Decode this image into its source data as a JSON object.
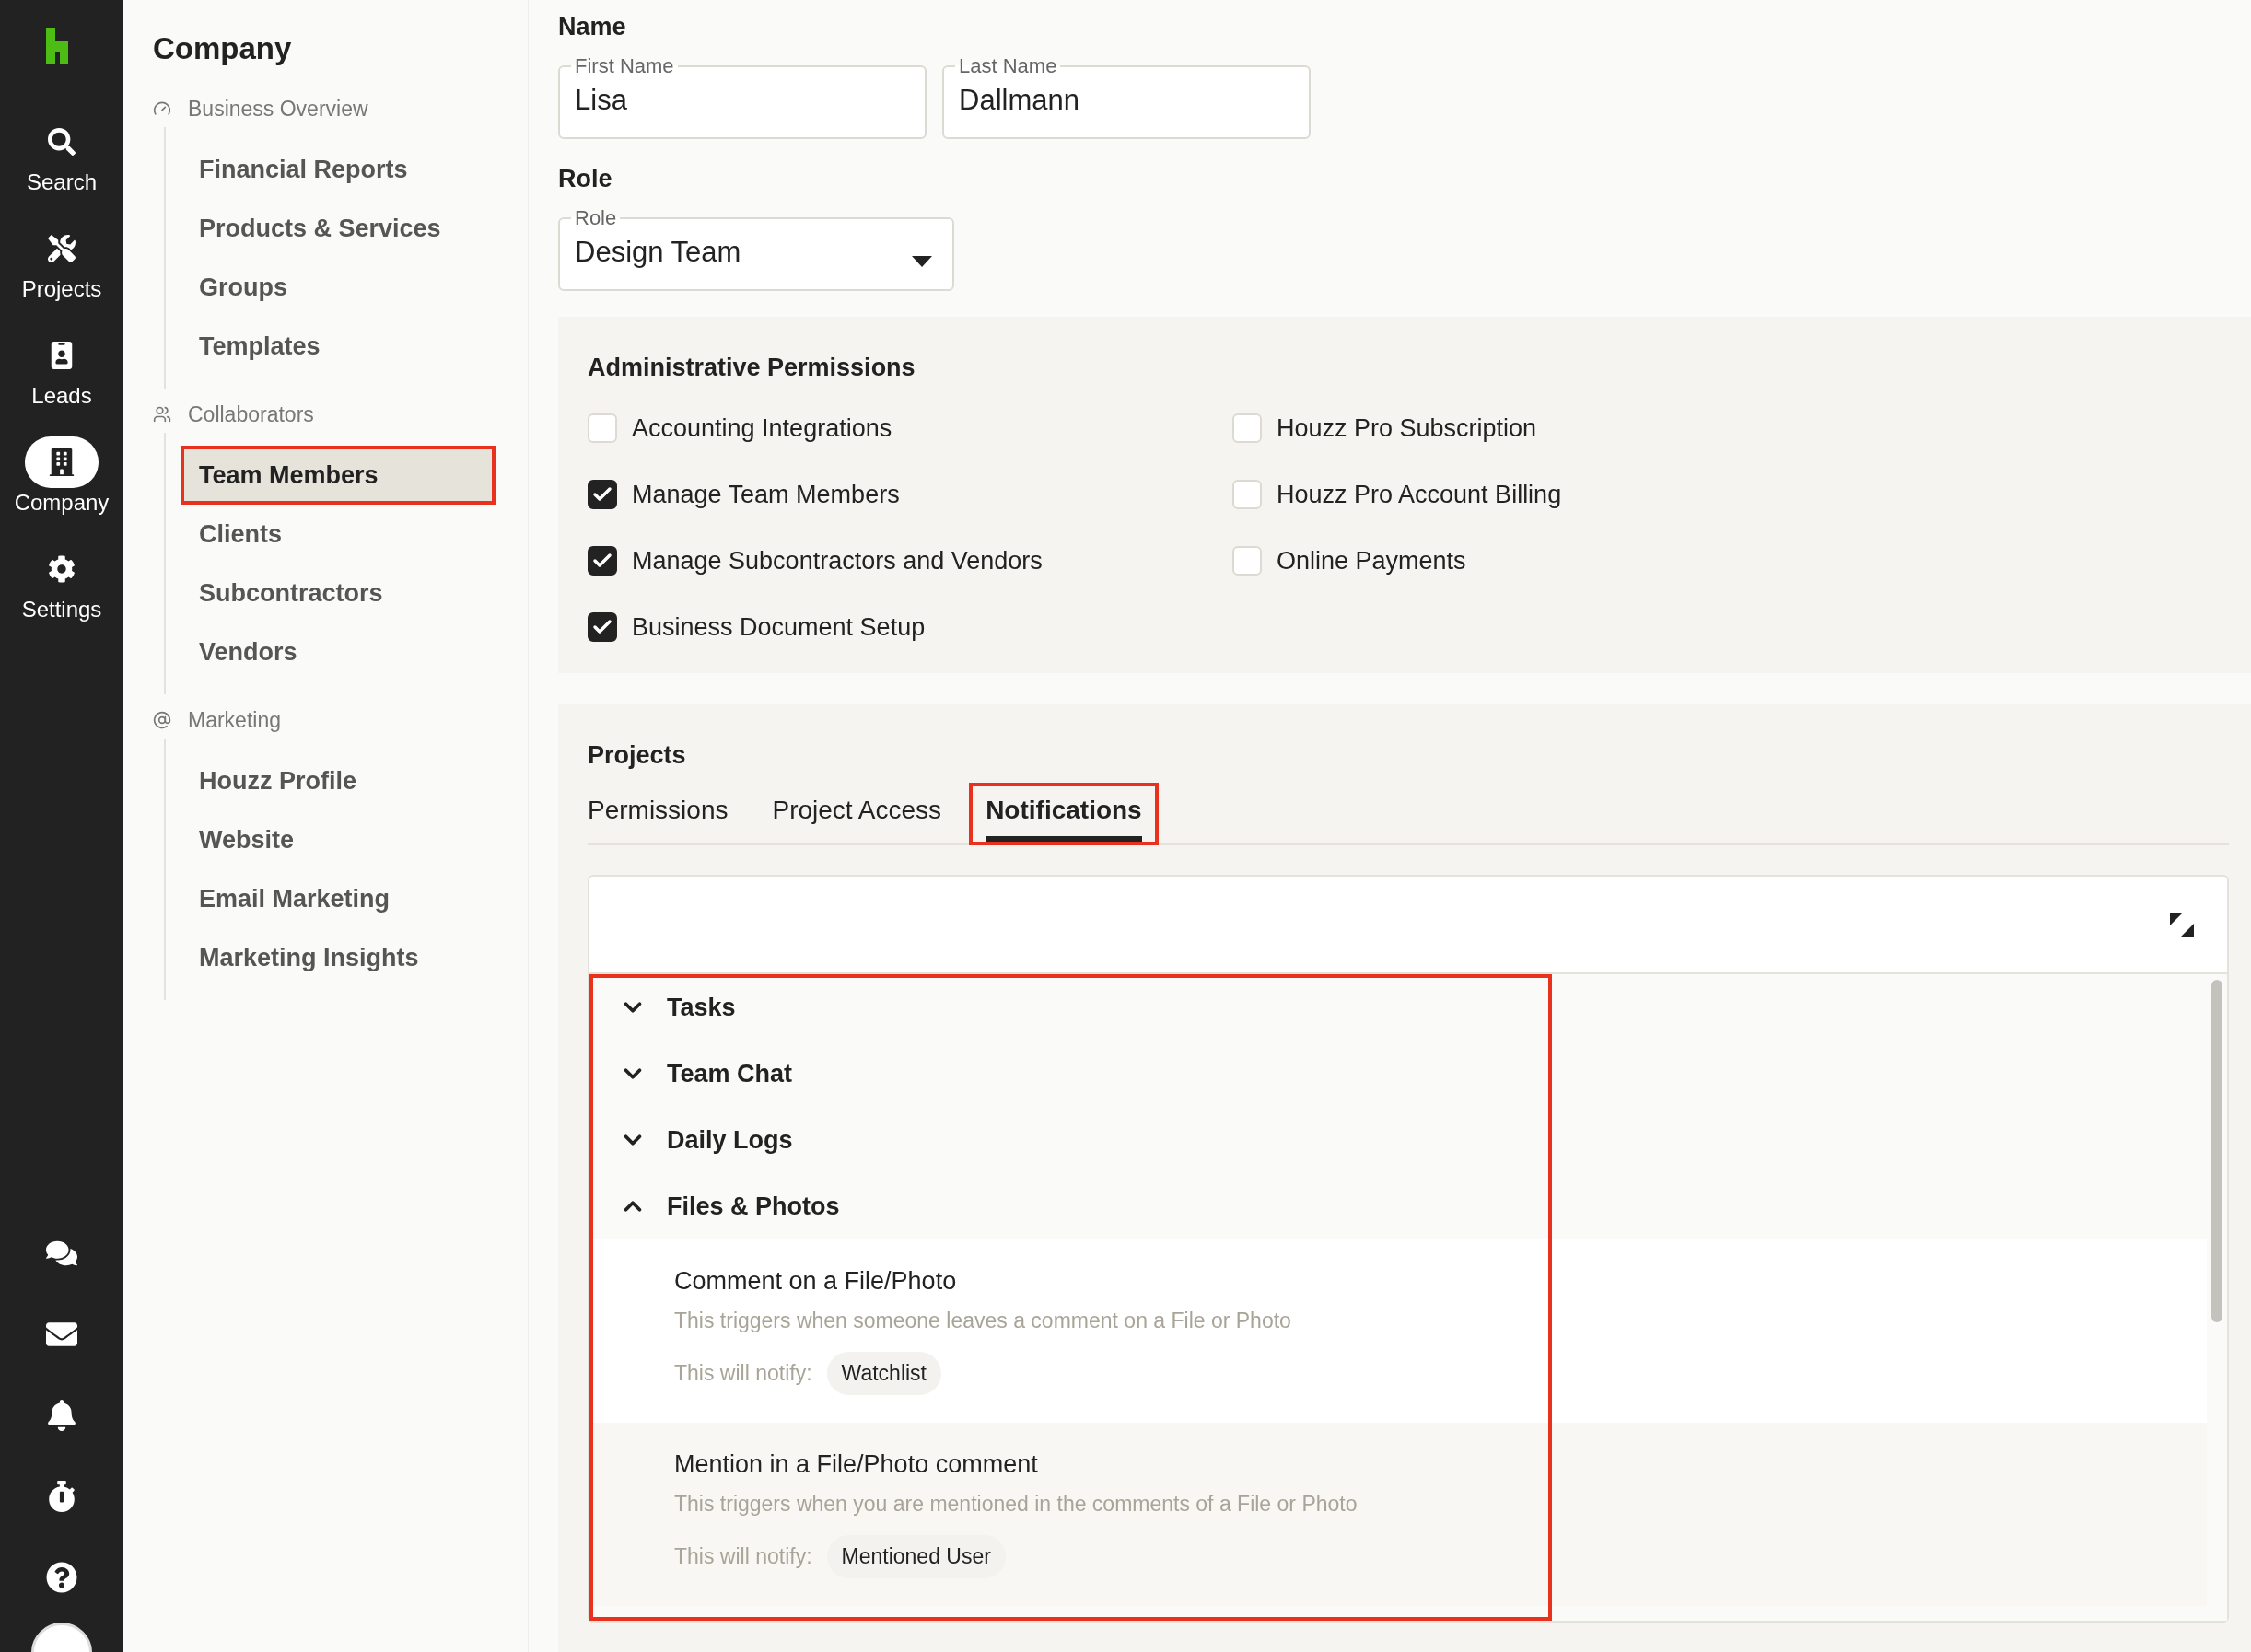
{
  "rail": {
    "items": [
      {
        "label": "Search",
        "selected": false
      },
      {
        "label": "Projects",
        "selected": false
      },
      {
        "label": "Leads",
        "selected": false
      },
      {
        "label": "Company",
        "selected": true
      },
      {
        "label": "Settings",
        "selected": false
      }
    ]
  },
  "nav": {
    "title": "Company",
    "sections": [
      {
        "heading": "Business Overview",
        "items": [
          {
            "label": "Financial Reports",
            "selected": false
          },
          {
            "label": "Products & Services",
            "selected": false
          },
          {
            "label": "Groups",
            "selected": false
          },
          {
            "label": "Templates",
            "selected": false
          }
        ]
      },
      {
        "heading": "Collaborators",
        "items": [
          {
            "label": "Team Members",
            "selected": true
          },
          {
            "label": "Clients",
            "selected": false
          },
          {
            "label": "Subcontractors",
            "selected": false
          },
          {
            "label": "Vendors",
            "selected": false
          }
        ]
      },
      {
        "heading": "Marketing",
        "items": [
          {
            "label": "Houzz Profile",
            "selected": false
          },
          {
            "label": "Website",
            "selected": false
          },
          {
            "label": "Email Marketing",
            "selected": false
          },
          {
            "label": "Marketing Insights",
            "selected": false
          }
        ]
      }
    ]
  },
  "name_section": {
    "title": "Name",
    "fields": [
      {
        "label": "First Name",
        "value": "Lisa"
      },
      {
        "label": "Last Name",
        "value": "Dallmann"
      }
    ]
  },
  "role_section": {
    "title": "Role",
    "select": {
      "label": "Role",
      "value": "Design Team"
    }
  },
  "admin": {
    "title": "Administrative Permissions",
    "columns": [
      {
        "items": [
          {
            "label": "Accounting Integrations",
            "checked": false
          },
          {
            "label": "Manage Team Members",
            "checked": true
          },
          {
            "label": "Manage Subcontractors and Vendors",
            "checked": true
          },
          {
            "label": "Business Document Setup",
            "checked": true
          }
        ]
      },
      {
        "items": [
          {
            "label": "Houzz Pro Subscription",
            "checked": false
          },
          {
            "label": "Houzz Pro Account Billing",
            "checked": false
          },
          {
            "label": "Online Payments",
            "checked": false
          }
        ]
      }
    ]
  },
  "projects": {
    "title": "Projects",
    "tabs": [
      {
        "label": "Permissions",
        "selected": false
      },
      {
        "label": "Project Access",
        "selected": false
      },
      {
        "label": "Notifications",
        "selected": true
      }
    ],
    "notifications": [
      {
        "label": "Tasks",
        "expanded": false
      },
      {
        "label": "Team Chat",
        "expanded": false
      },
      {
        "label": "Daily Logs",
        "expanded": false
      },
      {
        "label": "Files & Photos",
        "expanded": true,
        "children": [
          {
            "title": "Comment on a File/Photo",
            "description": "This triggers when someone leaves a comment on a File or Photo",
            "notify_label": "This will notify:",
            "recipient": "Watchlist"
          },
          {
            "title": "Mention in a File/Photo comment",
            "description": "This triggers when you are mentioned in the comments of a File or Photo",
            "notify_label": "This will notify:",
            "recipient": "Mentioned User"
          }
        ]
      }
    ]
  }
}
